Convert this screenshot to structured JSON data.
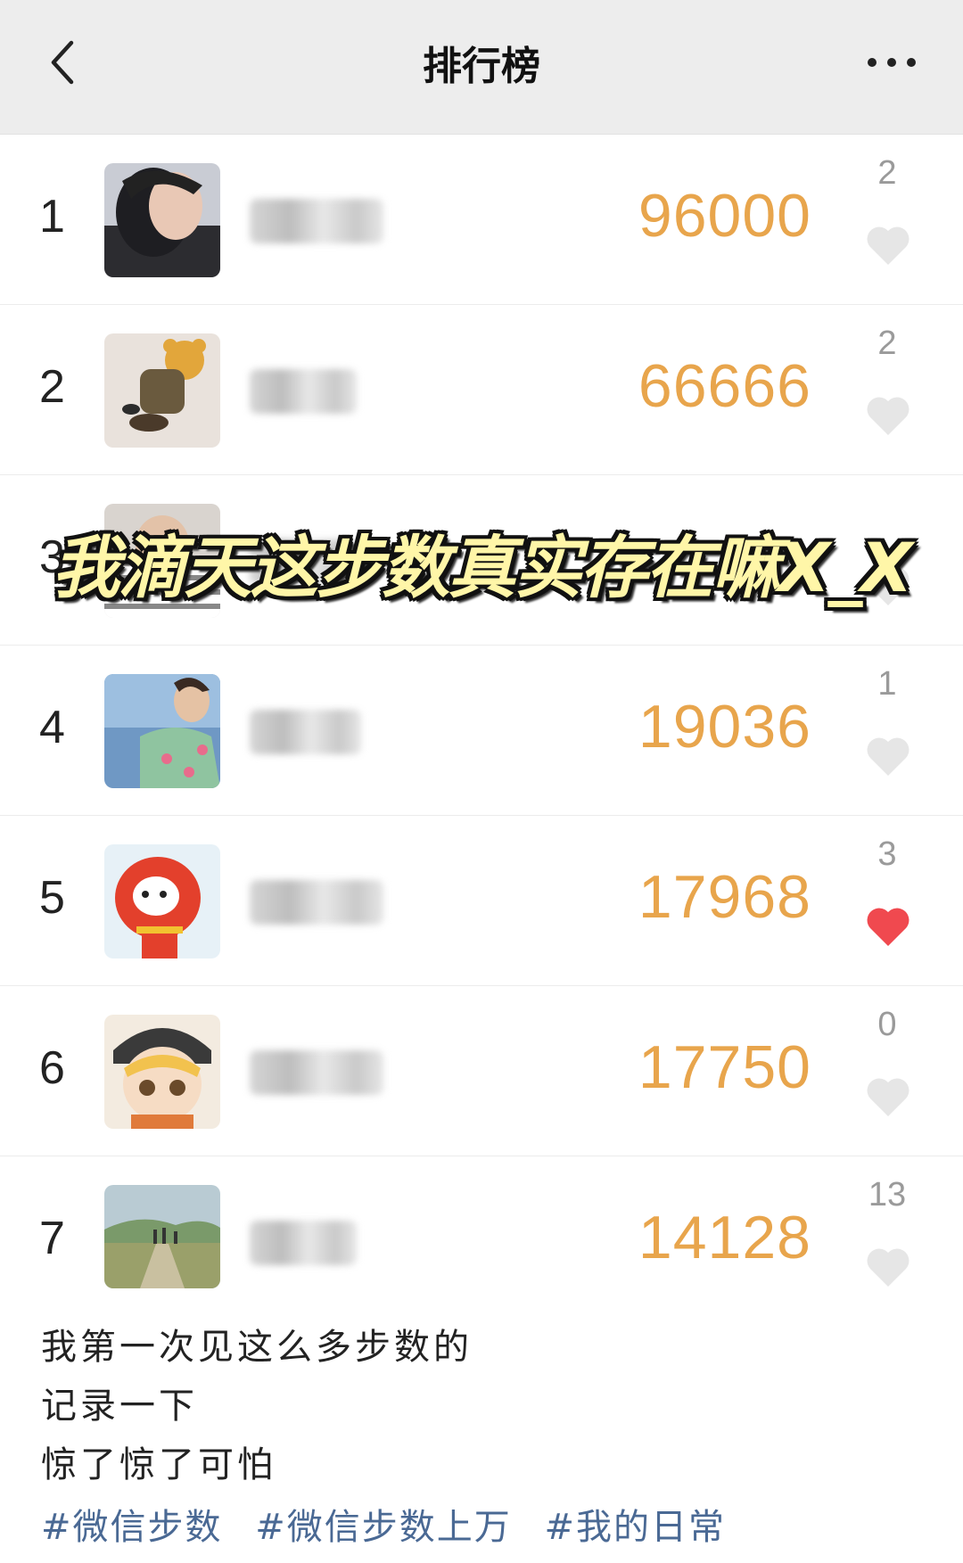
{
  "header": {
    "title": "排行榜"
  },
  "icons": {
    "back": "chevron-left-icon",
    "more": "more-dots-icon",
    "heart": "heart-icon"
  },
  "colors": {
    "steps": "#e8a54c",
    "heart_empty": "#e6e6e6",
    "heart_liked": "#f0494f",
    "tag": "#4a6994"
  },
  "rows": [
    {
      "rank": "1",
      "steps": "96000",
      "likes": "2",
      "liked": false
    },
    {
      "rank": "2",
      "steps": "66666",
      "likes": "2",
      "liked": false
    },
    {
      "rank": "3",
      "steps": "",
      "likes": "",
      "liked": false
    },
    {
      "rank": "4",
      "steps": "19036",
      "likes": "1",
      "liked": false
    },
    {
      "rank": "5",
      "steps": "17968",
      "likes": "3",
      "liked": true
    },
    {
      "rank": "6",
      "steps": "17750",
      "likes": "0",
      "liked": false
    },
    {
      "rank": "7",
      "steps": "14128",
      "likes": "13",
      "liked": false
    }
  ],
  "overlay_text": "我滴天这步数真实存在嘛X_X",
  "caption": {
    "lines": [
      "我第一次见这么多步数的",
      "记录一下",
      "惊了惊了可怕"
    ],
    "tags": [
      "#微信步数",
      "#微信步数上万",
      "#我的日常"
    ]
  }
}
